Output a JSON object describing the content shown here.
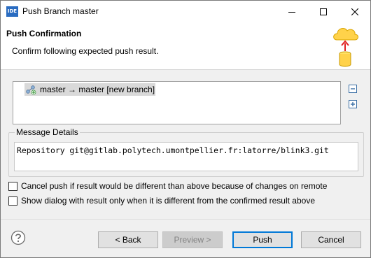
{
  "window": {
    "app_icon_text": "IDE",
    "title": "Push Branch master"
  },
  "header": {
    "title": "Push Confirmation",
    "message": "Confirm following expected push result."
  },
  "push_updates": {
    "items": [
      {
        "label": "master → master [new branch]",
        "icon": "git-push-ref-icon",
        "selected": true
      }
    ]
  },
  "message_details": {
    "legend": "Message Details",
    "text": "Repository git@gitlab.polytech.umontpellier.fr:latorre/blink3.git"
  },
  "options": {
    "cancel_if_different": {
      "label": "Cancel push if result would be different than above because of changes on remote",
      "checked": false
    },
    "show_if_different": {
      "label": "Show dialog with result only when it is different from the confirmed result above",
      "checked": false
    }
  },
  "buttons": {
    "back": "< Back",
    "preview": "Preview >",
    "push": "Push",
    "cancel": "Cancel"
  },
  "colors": {
    "default_button_border": "#0078d7",
    "selection": "#d9d9d9",
    "app_icon": "#2a6cc1"
  }
}
